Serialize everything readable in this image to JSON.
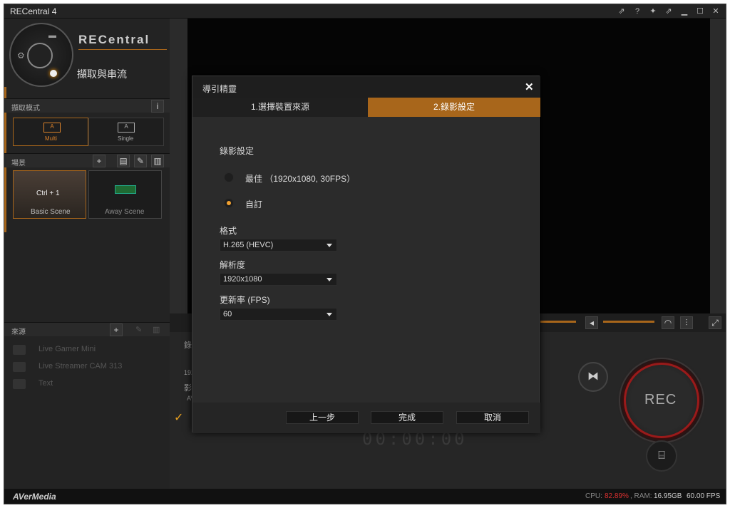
{
  "window": {
    "title": "RECentral 4",
    "title_buttons": [
      "pin-icon",
      "help-icon",
      "pin2-icon",
      "pin3-icon",
      "minimize-icon",
      "maximize-icon",
      "close-icon"
    ]
  },
  "left": {
    "brand": "RECentral",
    "mode_title": "擷取與串流",
    "capture_mode_header": "擷取模式",
    "modes": [
      {
        "icon": "A",
        "label": "Multi"
      },
      {
        "icon": "A",
        "label": "Single"
      }
    ],
    "scene_header": "場景",
    "scenes": [
      {
        "label": "Basic Scene",
        "hotkey": "Ctrl + 1"
      },
      {
        "label": "Away Scene",
        "hotkey": ""
      }
    ],
    "source_header": "來源",
    "sources": [
      "Live Gamer Mini",
      "Live Streamer CAM 313",
      "Text"
    ]
  },
  "lower": {
    "partial_labels": [
      "錄",
      "192",
      "影",
      "AV"
    ],
    "counter": "00:00:00",
    "rec_label": "REC"
  },
  "status": {
    "brand": "AVerMedia",
    "cpu_label": "CPU:",
    "cpu_value": "82.89%",
    "ram_label": ", RAM:",
    "ram_value": "16.95GB",
    "fps": "60.00 FPS"
  },
  "dialog": {
    "title": "導引精靈",
    "tabs": [
      {
        "label": "1.選擇裝置來源",
        "active": false
      },
      {
        "label": "2.錄影設定",
        "active": true
      }
    ],
    "section_title": "錄影設定",
    "radio_best": "最佳 （1920x1080, 30FPS）",
    "radio_custom": "自訂",
    "format_label": "格式",
    "format_value": "H.265 (HEVC)",
    "resolution_label": "解析度",
    "resolution_value": "1920x1080",
    "fps_label": "更新率 (FPS)",
    "fps_value": "60",
    "btn_prev": "上一步",
    "btn_done": "完成",
    "btn_cancel": "取消"
  },
  "colors": {
    "accent": "#a8661b",
    "radio_selected": "#f0a030",
    "cpu_value": "#d83030"
  }
}
